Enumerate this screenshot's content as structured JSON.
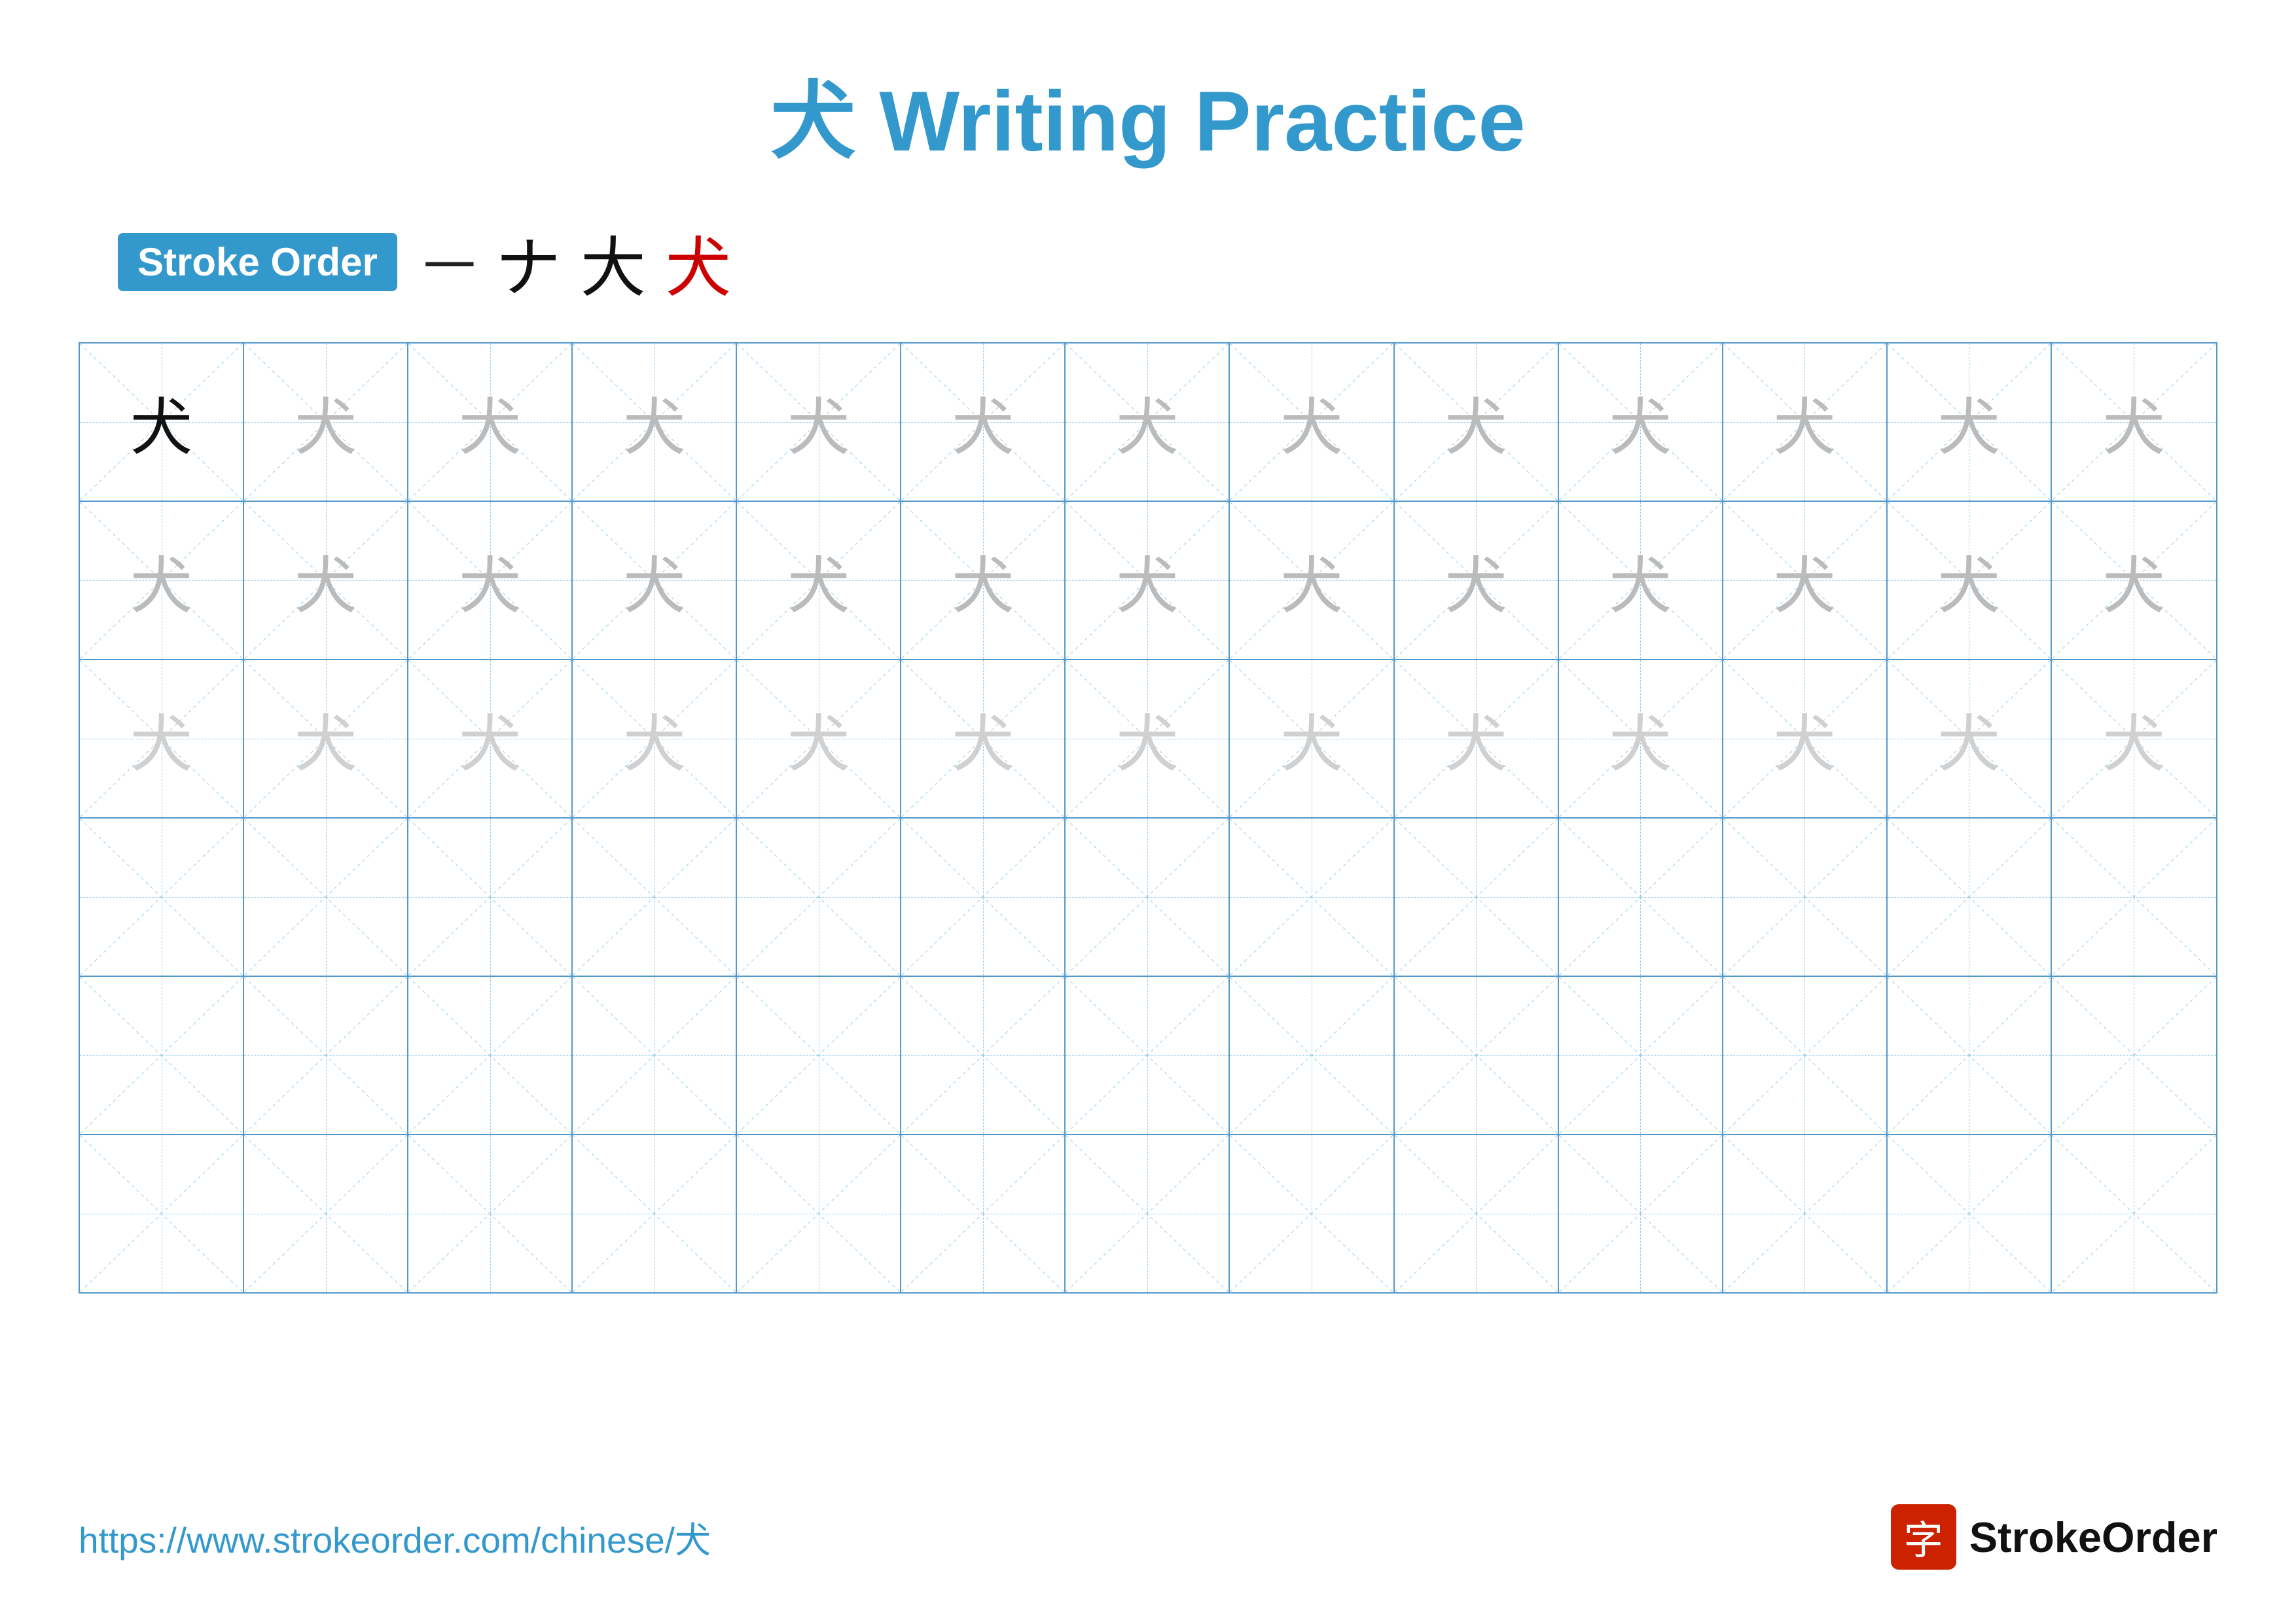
{
  "title": {
    "char": "犬",
    "label": "Writing Practice",
    "color": "#3399cc"
  },
  "stroke_order": {
    "badge": "Stroke Order",
    "separator": "一",
    "strokes": [
      "ナ",
      "大",
      "犬"
    ],
    "stroke_colors": [
      "black",
      "black",
      "black"
    ]
  },
  "grid": {
    "cols": 13,
    "rows": 6,
    "char": "犬",
    "row_types": [
      "solid_then_dark",
      "gray_dark",
      "gray_light",
      "empty",
      "empty",
      "empty"
    ]
  },
  "footer": {
    "url": "https://www.strokeorder.com/chinese/犬",
    "logo_char": "字",
    "logo_name": "StrokeOrder"
  }
}
